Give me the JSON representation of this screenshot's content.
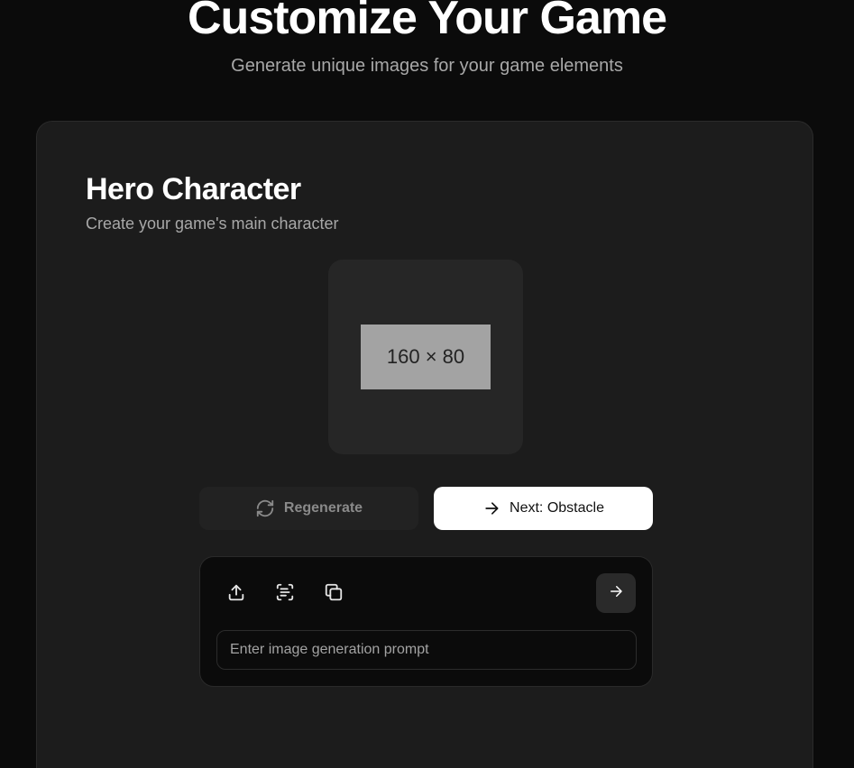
{
  "header": {
    "title": "Customize Your Game",
    "subtitle": "Generate unique images for your game elements"
  },
  "card": {
    "title": "Hero Character",
    "subtitle": "Create your game's main character",
    "preview_placeholder": "160 × 80"
  },
  "actions": {
    "regenerate_label": "Regenerate",
    "next_label": "Next: Obstacle"
  },
  "prompt": {
    "placeholder": "Enter image generation prompt",
    "value": ""
  },
  "icons": {
    "regenerate": "refresh-icon",
    "next": "arrow-right-icon",
    "upload": "upload-icon",
    "scan": "scan-text-icon",
    "copy": "copy-icon",
    "send": "arrow-right-icon"
  },
  "colors": {
    "background": "#0b0b0b",
    "card": "#1c1c1c",
    "preview": "#262626",
    "placeholder": "#a3a3a3",
    "primary_button": "#ffffff",
    "muted_text": "#a8a8a8"
  }
}
